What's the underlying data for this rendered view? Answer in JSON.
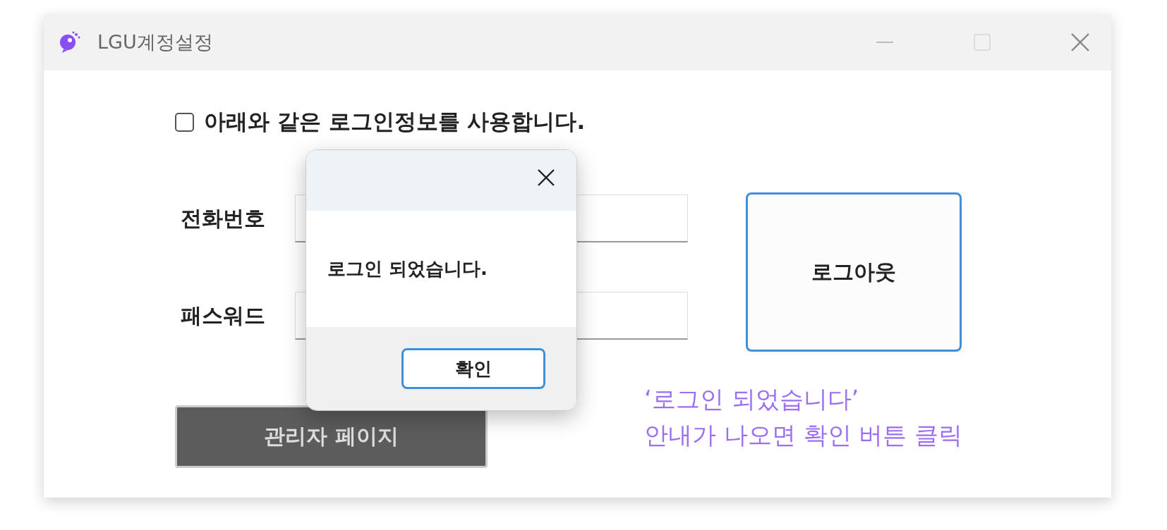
{
  "window": {
    "title": "LGU계정설정"
  },
  "use_login_info": {
    "label": "아래와 같은 로그인정보를 사용합니다.",
    "checked": false
  },
  "fields": [
    {
      "label": "전화번호"
    },
    {
      "label": "패스워드"
    }
  ],
  "logout_button": "로그아웃",
  "admin_button": "관리자 페이지",
  "dialog": {
    "message": "로그인 되었습니다.",
    "ok_button": "확인"
  },
  "annotation": [
    "‘로그인 되었습니다’",
    "안내가 나오면 확인 버튼 클릭"
  ]
}
